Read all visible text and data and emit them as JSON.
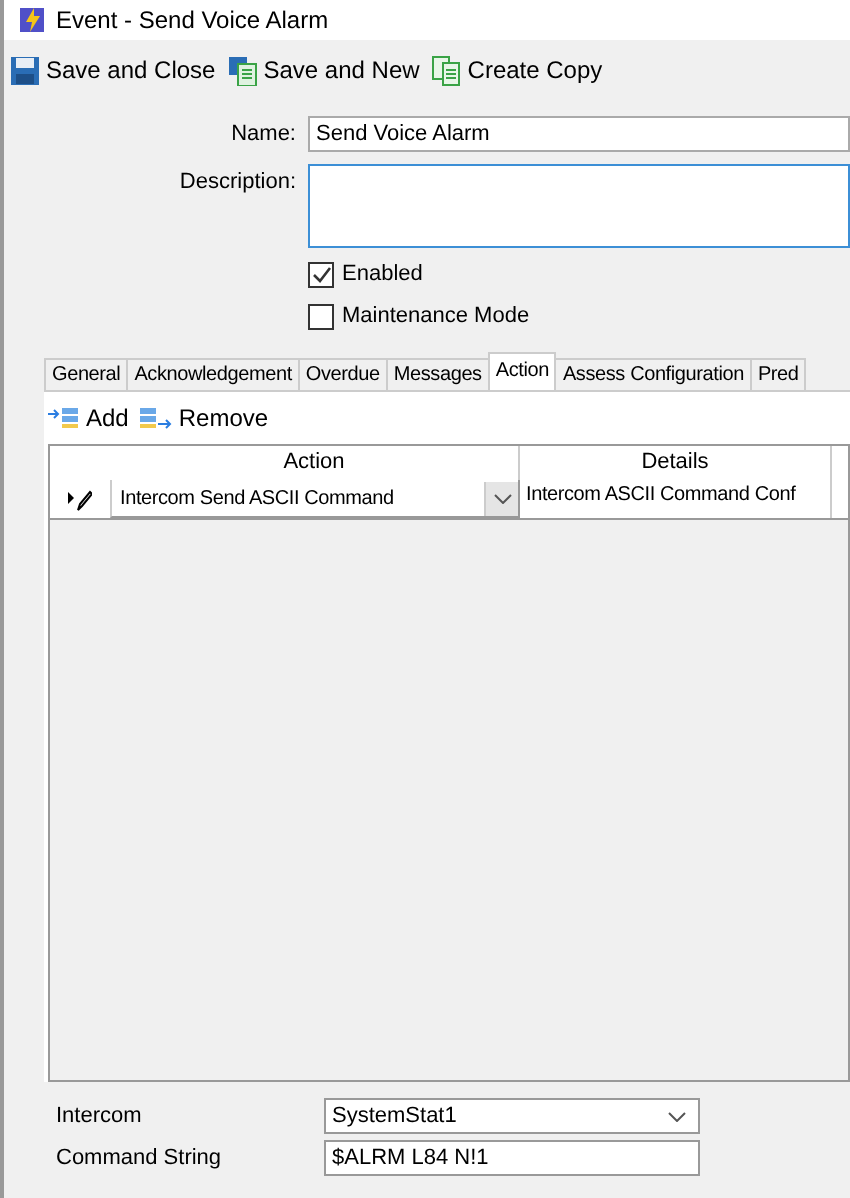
{
  "window": {
    "title": "Event  -  Send Voice Alarm"
  },
  "toolbar": [
    {
      "label": "Save and Close"
    },
    {
      "label": "Save and New"
    },
    {
      "label": "Create Copy"
    }
  ],
  "form": {
    "name": {
      "label": "Name:",
      "value": "Send Voice Alarm"
    },
    "description": {
      "label": "Description:"
    },
    "checkboxes": [
      {
        "label": "Enabled",
        "checked": true
      },
      {
        "label": "Maintenance Mode",
        "checked": false
      }
    ]
  },
  "tabs": [
    {
      "label": "General",
      "selected": false
    },
    {
      "label": "Acknowledgement",
      "selected": false
    },
    {
      "label": "Overdue",
      "selected": false
    },
    {
      "label": "Messages",
      "selected": false
    },
    {
      "label": "Action",
      "selected": true
    },
    {
      "label": "Assess Configuration",
      "selected": false
    },
    {
      "label": "Pred",
      "selected": false
    }
  ],
  "action_toolbar": [
    {
      "label": "Add"
    },
    {
      "label": "Remove"
    }
  ],
  "table": {
    "columns": [
      "Action",
      "Details"
    ],
    "rows": [
      {
        "action": "Intercom Send ASCII Command",
        "details": "Intercom ASCII Command Conf"
      }
    ]
  },
  "settings": [
    {
      "kind": "combo",
      "label": "Intercom",
      "value": "SystemStat1"
    },
    {
      "kind": "text",
      "label": "Command String",
      "value": "$ALRM L84 N!1"
    }
  ]
}
